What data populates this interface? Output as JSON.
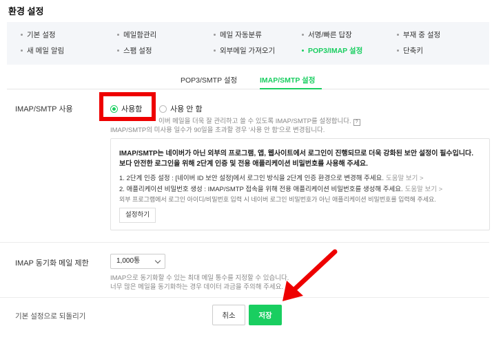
{
  "page": {
    "title": "환경 설정"
  },
  "nav": {
    "items": [
      {
        "label": "기본 설정"
      },
      {
        "label": "메일함관리"
      },
      {
        "label": "메일 자동분류"
      },
      {
        "label": "서명/빠른 답장"
      },
      {
        "label": "부재 중 설정"
      },
      {
        "label": "새 메일 알림"
      },
      {
        "label": "스팸 설정"
      },
      {
        "label": "외부메일 가져오기"
      },
      {
        "label": "POP3/IMAP 설정",
        "active": true
      },
      {
        "label": "단축키"
      }
    ]
  },
  "tabs": [
    {
      "label": "POP3/SMTP 설정"
    },
    {
      "label": "IMAP/SMTP 설정",
      "active": true
    }
  ],
  "imap_smtp": {
    "label": "IMAP/SMTP 사용",
    "option_use": "사용함",
    "option_not_use": "사용 안 함",
    "selected": "사용함",
    "help_line1": "이버 메일을 더욱 잘 관리하고 쓸 수 있도록 IMAP/SMTP를 설정합니다.",
    "help_icon": "?",
    "help_line2": "IMAP/SMTP의 미사용 일수가 90일을 초과할 경우 '사용 안 함'으로 변경됩니다."
  },
  "info_box": {
    "title_line1": "IMAP/SMTP는 네이버가 아닌 외부의 프로그램, 앱, 웹사이트에서 로그인이 진행되므로 더욱 강화된 보안 설정이 필수입니다.",
    "title_line2": "보다 안전한 로그인을 위해 2단계 인증 및 전용 애플리케이션 비밀번호를 사용해 주세요.",
    "step1": "1. 2단계 인증 설정 : [네이버 ID 보안 설정]에서 로그인 방식을 2단계 인증 환경으로 변경해 주세요.",
    "step1_link": "도움말 보기 >",
    "step2": "2. 애플리케이션 비밀번호 생성 : IMAP/SMTP 접속을 위해 전용 애플리케이션 비밀번호를 생성해 주세요.",
    "step2_link": "도움말 보기 >",
    "note": "외부 프로그램에서 로그인 아이디/비밀번호 입력 시 네이버 로그인 비밀번호가 아닌 애플리케이션 비밀번호를 입력해 주세요.",
    "setup_button": "설정하기"
  },
  "sync_limit": {
    "label": "IMAP 동기화 메일 제한",
    "selected": "1,000통",
    "help_line1": "IMAP으로 동기화할 수 있는 최대 메일 통수를 지정할 수 있습니다.",
    "help_line2": "너무 많은 메일을 동기화하는 경우 데이터 과금을 주의해 주세요."
  },
  "footer": {
    "reset_label": "기본 설정으로 되돌리기",
    "cancel_label": "취소",
    "save_label": "저장"
  },
  "colors": {
    "accent": "#19ce60",
    "highlight": "#ee0000"
  }
}
